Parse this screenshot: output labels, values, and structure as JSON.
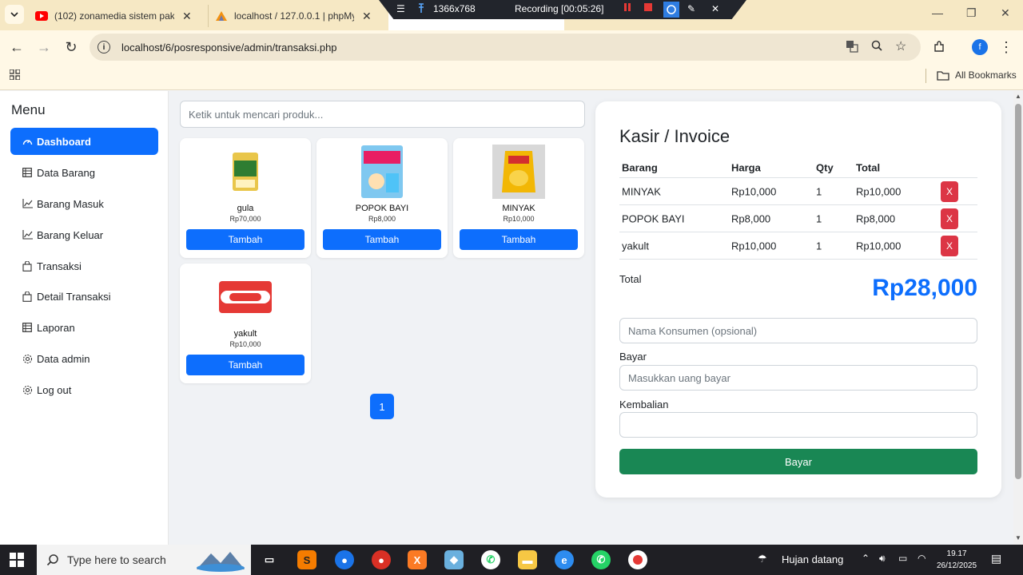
{
  "browser": {
    "tabs": [
      {
        "label": "(102) zonamedia sistem pakar",
        "icon": "youtube-icon"
      },
      {
        "label": "localhost / 127.0.0.1 | phpMyAd",
        "icon": "phpmyadmin-icon"
      }
    ],
    "url": "localhost/6/posresponsive/admin/transaksi.php",
    "bookmarks_label": "All Bookmarks",
    "profile_initial": "f"
  },
  "recorder": {
    "resolution": "1366x768",
    "status": "Recording [00:05:26]"
  },
  "sidebar": {
    "title": "Menu",
    "items": [
      {
        "label": "Dashboard",
        "icon": "speedometer-icon"
      },
      {
        "label": "Data Barang",
        "icon": "table-icon"
      },
      {
        "label": "Barang Masuk",
        "icon": "chart-line-icon"
      },
      {
        "label": "Barang Keluar",
        "icon": "chart-line-icon"
      },
      {
        "label": "Transaksi",
        "icon": "bag-icon"
      },
      {
        "label": "Detail Transaksi",
        "icon": "bag-icon"
      },
      {
        "label": "Laporan",
        "icon": "table-icon"
      },
      {
        "label": "Data admin",
        "icon": "gear-icon"
      },
      {
        "label": "Log out",
        "icon": "gear-icon"
      }
    ]
  },
  "products": {
    "search_placeholder": "Ketik untuk mencari produk...",
    "button_label": "Tambah",
    "items": [
      {
        "name": "gula",
        "price": "Rp70,000"
      },
      {
        "name": "POPOK BAYI",
        "price": "Rp8,000"
      },
      {
        "name": "MINYAK",
        "price": "Rp10,000"
      },
      {
        "name": "yakult",
        "price": "Rp10,000"
      }
    ],
    "page": "1"
  },
  "invoice": {
    "title": "Kasir / Invoice",
    "headers": [
      "Barang",
      "Harga",
      "Qty",
      "Total"
    ],
    "rows": [
      {
        "barang": "MINYAK",
        "harga": "Rp10,000",
        "qty": "1",
        "total": "Rp10,000",
        "remove": "X"
      },
      {
        "barang": "POPOK BAYI",
        "harga": "Rp8,000",
        "qty": "1",
        "total": "Rp8,000",
        "remove": "X"
      },
      {
        "barang": "yakult",
        "harga": "Rp10,000",
        "qty": "1",
        "total": "Rp10,000",
        "remove": "X"
      }
    ],
    "total_label": "Total",
    "total_value": "Rp28,000",
    "customer_placeholder": "Nama Konsumen (opsional)",
    "bayar_label": "Bayar",
    "bayar_placeholder": "Masukkan uang bayar",
    "kembalian_label": "Kembalian",
    "kembalian_value": "",
    "pay_button": "Bayar"
  },
  "taskbar": {
    "search_placeholder": "Type here to search",
    "weather": "Hujan datang",
    "time": "19.17",
    "date": "26/12/2025"
  },
  "colors": {
    "primary": "#0d6efd",
    "danger": "#dc3545",
    "success": "#198754"
  }
}
